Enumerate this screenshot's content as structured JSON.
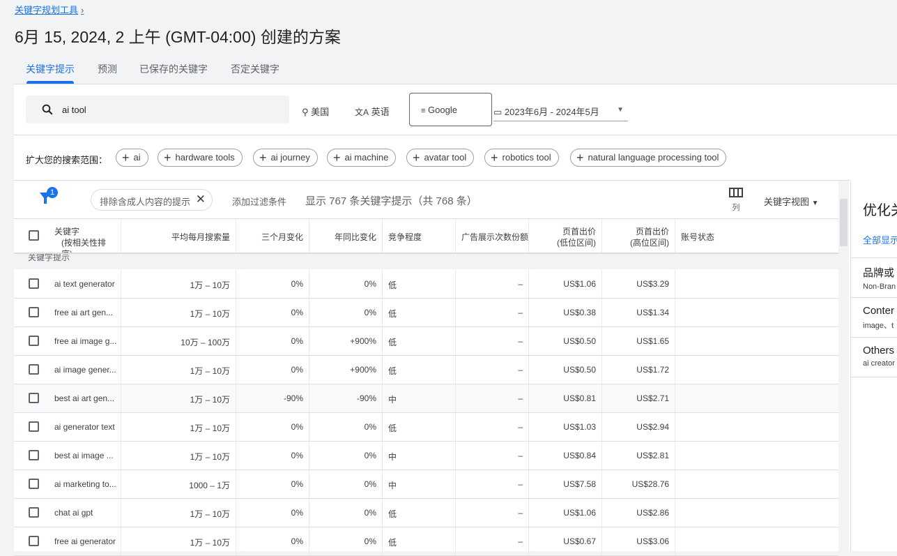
{
  "breadcrumb": {
    "label": "关键字规划工具",
    "chevron": "›"
  },
  "title": "6月 15, 2024, 2 上午 (GMT-04:00) 创建的方案",
  "tabs": [
    {
      "label": "关键字提示",
      "active": true
    },
    {
      "label": "预测"
    },
    {
      "label": "已保存的关键字"
    },
    {
      "label": "否定关键字"
    }
  ],
  "search": {
    "value": "ai tool",
    "location": "美国",
    "language": "英语",
    "network": "Google",
    "date_range": "2023年6月 - 2024年5月"
  },
  "expand": {
    "label": "扩大您的搜索范围：",
    "chips": [
      "ai",
      "hardware tools",
      "ai journey",
      "ai machine",
      "avatar tool",
      "robotics tool",
      "natural language processing tool"
    ]
  },
  "filters": {
    "badge": "1",
    "chip": "排除含成人内容的提示",
    "add": "添加过滤条件",
    "summary": "显示 767 条关键字提示（共 768 条）",
    "columns_label": "列",
    "view_label": "关键字视图"
  },
  "table": {
    "headers": [
      "关键字",
      "(按相关性排序)",
      "平均每月搜索量",
      "三个月变化",
      "年同比变化",
      "竞争程度",
      "广告展示次数份额",
      "页首出价",
      "(低位区间)",
      "页首出价",
      "(高位区间)",
      "账号状态"
    ],
    "group_label": "关键字提示",
    "rows": [
      [
        "ai text generator",
        "1万 – 10万",
        "0%",
        "0%",
        "低",
        "–",
        "US$1.06",
        "US$3.29"
      ],
      [
        "free ai art gen...",
        "1万 – 10万",
        "0%",
        "0%",
        "低",
        "–",
        "US$0.38",
        "US$1.34"
      ],
      [
        "free ai image g...",
        "10万 – 100万",
        "0%",
        "+900%",
        "低",
        "–",
        "US$0.50",
        "US$1.65"
      ],
      [
        "ai image gener...",
        "1万 – 10万",
        "0%",
        "+900%",
        "低",
        "–",
        "US$0.50",
        "US$1.72"
      ],
      [
        "best ai art gen...",
        "1万 – 10万",
        "-90%",
        "-90%",
        "中",
        "–",
        "US$0.81",
        "US$2.71"
      ],
      [
        "ai generator text",
        "1万 – 10万",
        "0%",
        "0%",
        "低",
        "–",
        "US$1.03",
        "US$2.94"
      ],
      [
        "best ai image ...",
        "1万 – 10万",
        "0%",
        "0%",
        "中",
        "–",
        "US$0.84",
        "US$2.81"
      ],
      [
        "ai marketing to...",
        "1000 – 1万",
        "0%",
        "0%",
        "中",
        "–",
        "US$7.58",
        "US$28.76"
      ],
      [
        "chat ai gpt",
        "1万 – 10万",
        "0%",
        "0%",
        "低",
        "–",
        "US$1.06",
        "US$2.86"
      ],
      [
        "free ai generator",
        "1万 – 10万",
        "0%",
        "0%",
        "低",
        "–",
        "US$0.67",
        "US$3.06"
      ]
    ]
  },
  "side": {
    "title": "优化关",
    "show_all": "全部显示",
    "items": [
      {
        "title": "品牌或",
        "sub": "Non-Bran"
      },
      {
        "title": "Conter",
        "sub": "image、t"
      },
      {
        "title": "Others",
        "sub": "ai creator"
      }
    ]
  },
  "colors": {
    "accent": "#1a73e8",
    "highlight_row": "#f8f9fa"
  }
}
